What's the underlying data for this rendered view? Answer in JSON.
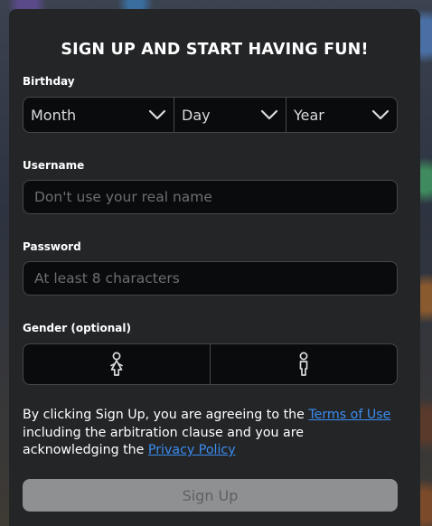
{
  "form": {
    "title": "SIGN UP AND START HAVING FUN!",
    "birthday": {
      "label": "Birthday",
      "month": "Month",
      "day": "Day",
      "year": "Year"
    },
    "username": {
      "label": "Username",
      "value": "",
      "placeholder": "Don't use your real name"
    },
    "password": {
      "label": "Password",
      "value": "",
      "placeholder": "At least 8 characters"
    },
    "gender": {
      "label": "Gender (optional)",
      "options": [
        {
          "icon": "female-icon"
        },
        {
          "icon": "male-icon"
        }
      ]
    },
    "terms": {
      "prefix": "By clicking Sign Up, you are agreeing to the ",
      "terms_link": "Terms of Use",
      "middle": " including the arbitration clause and you are acknowledging the ",
      "privacy_link": "Privacy Policy"
    },
    "submit_label": "Sign Up"
  },
  "colors": {
    "card_bg": "#232527",
    "field_bg": "#0a0b0c",
    "field_border": "#45484b",
    "link": "#3b8df0",
    "button_disabled_bg": "#8e9092",
    "button_disabled_text": "#5d5f62"
  }
}
